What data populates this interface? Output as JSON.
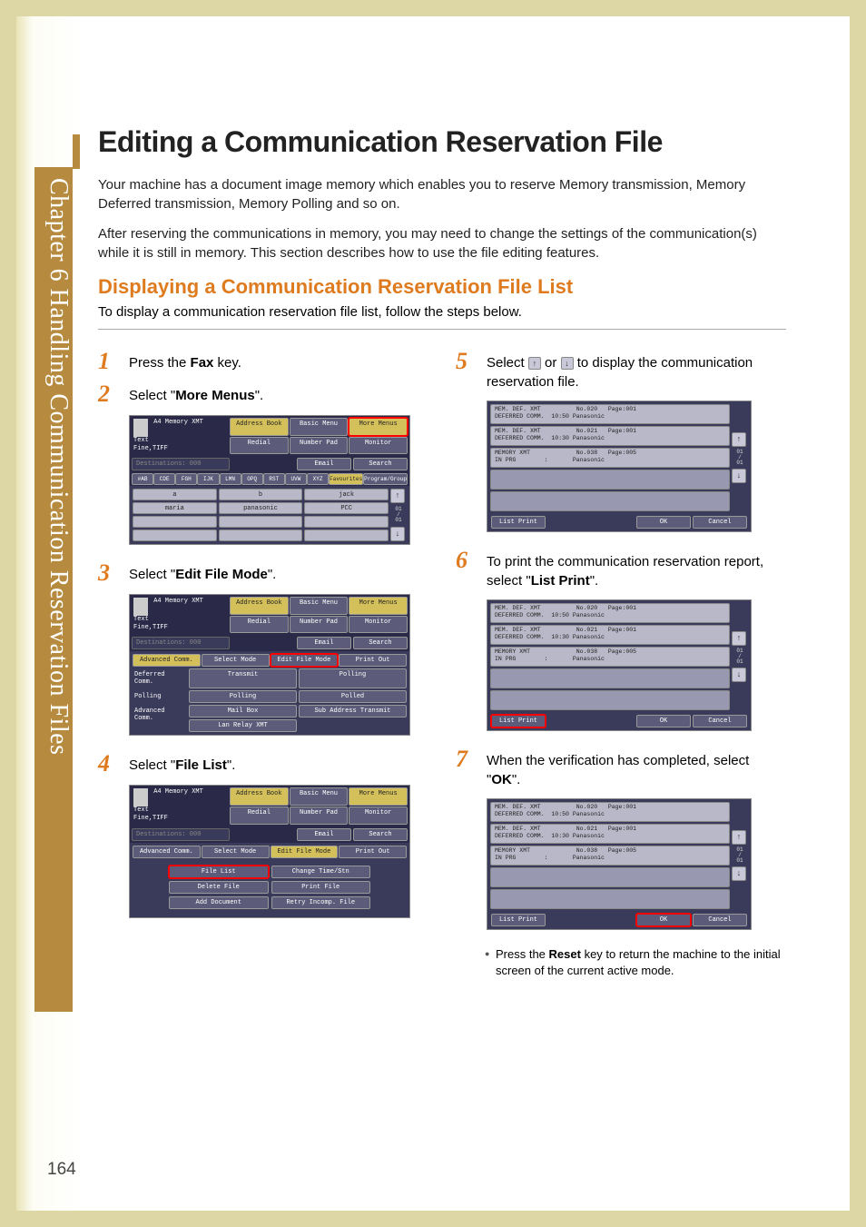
{
  "sidebar": {
    "chapter_label": "Chapter 6  Handling Communication Reservation Files"
  },
  "title": "Editing a Communication Reservation File",
  "intro1": "Your machine has a document image memory which enables you to reserve Memory transmission, Memory Deferred transmission, Memory Polling and so on.",
  "intro2": "After reserving the communications in memory, you may need to change the settings of the communication(s) while it is still in memory. This section describes how to use the file editing features.",
  "section_title": "Displaying a Communication Reservation File List",
  "section_intro": "To display a communication reservation file list, follow the steps below.",
  "steps": {
    "s1": {
      "num": "1",
      "pre": "Press the ",
      "strong": "Fax",
      "post": " key."
    },
    "s2": {
      "num": "2",
      "pre": "Select \"",
      "strong": "More Menus",
      "post": "\"."
    },
    "s3": {
      "num": "3",
      "pre": "Select \"",
      "strong": "Edit File Mode",
      "post": "\"."
    },
    "s4": {
      "num": "4",
      "pre": "Select \"",
      "strong": "File List",
      "post": "\"."
    },
    "s5": {
      "num": "5",
      "pre": "Select ",
      "mid": " or ",
      "post": " to display the communication reservation file."
    },
    "s6": {
      "num": "6",
      "pre": "To print the communication reservation report, select \"",
      "strong": "List Print",
      "post": "\"."
    },
    "s7": {
      "num": "7",
      "pre": "When the verification has completed, select \"",
      "strong": "OK",
      "post": "\"."
    }
  },
  "note": {
    "pre": "Press the ",
    "strong": "Reset",
    "post": " key to return the machine to the initial screen of the current active mode."
  },
  "page_number": "164",
  "shot_common": {
    "header_left_lines": "A4    Memory XMT\n      Text\n      Fine,TIFF",
    "dest": "Destinations: 000",
    "btns": {
      "address_book": "Address Book",
      "basic_menu": "Basic Menu",
      "more_menus": "More Menus",
      "redial": "Redial",
      "number_pad": "Number Pad",
      "monitor": "Monitor",
      "email": "Email",
      "search": "Search"
    }
  },
  "shot2": {
    "alpha": [
      "#AB",
      "CDE",
      "FGH",
      "IJK",
      "LMN",
      "OPQ",
      "RST",
      "UVW",
      "XYZ",
      "Favourites",
      "Program/Group"
    ],
    "entries": [
      "a",
      "b",
      "jack",
      "maria",
      "panasonic",
      "PCC"
    ],
    "page": "01\n/\n01"
  },
  "shot3": {
    "tabs": [
      "Advanced Comm.",
      "Select Mode",
      "Edit File Mode",
      "Print Out"
    ],
    "rows": [
      {
        "label": "Deferred Comm.",
        "b1": "Transmit",
        "b2": "Polling"
      },
      {
        "label": "Polling",
        "b1": "Polling",
        "b2": "Polled"
      },
      {
        "label": "Advanced Comm.",
        "b1": "Mail Box",
        "b2": "Sub Address Transmit",
        "b3": "Lan Relay XMT"
      }
    ]
  },
  "shot4": {
    "tabs": [
      "Advanced Comm.",
      "Select Mode",
      "Edit File Mode",
      "Print Out"
    ],
    "items": [
      "File List",
      "Change Time/Stn",
      "Delete File",
      "Print File",
      "Add Document",
      "Retry Incomp. File"
    ]
  },
  "list_shot": {
    "rows": [
      {
        "l1": "MEM. DEF. XMT          No.020   Page:001",
        "l2": "DEFERRED COMM.  10:50 Panasonic"
      },
      {
        "l1": "MEM. DEF. XMT          No.021   Page:001",
        "l2": "DEFERRED COMM.  10:30 Panasonic"
      },
      {
        "l1": "MEMORY XMT             No.038   Page:005",
        "l2": "IN PRG        :       Panasonic"
      }
    ],
    "page": "01\n/\n01",
    "footer": {
      "list_print": "List Print",
      "ok": "OK",
      "cancel": "Cancel"
    }
  }
}
